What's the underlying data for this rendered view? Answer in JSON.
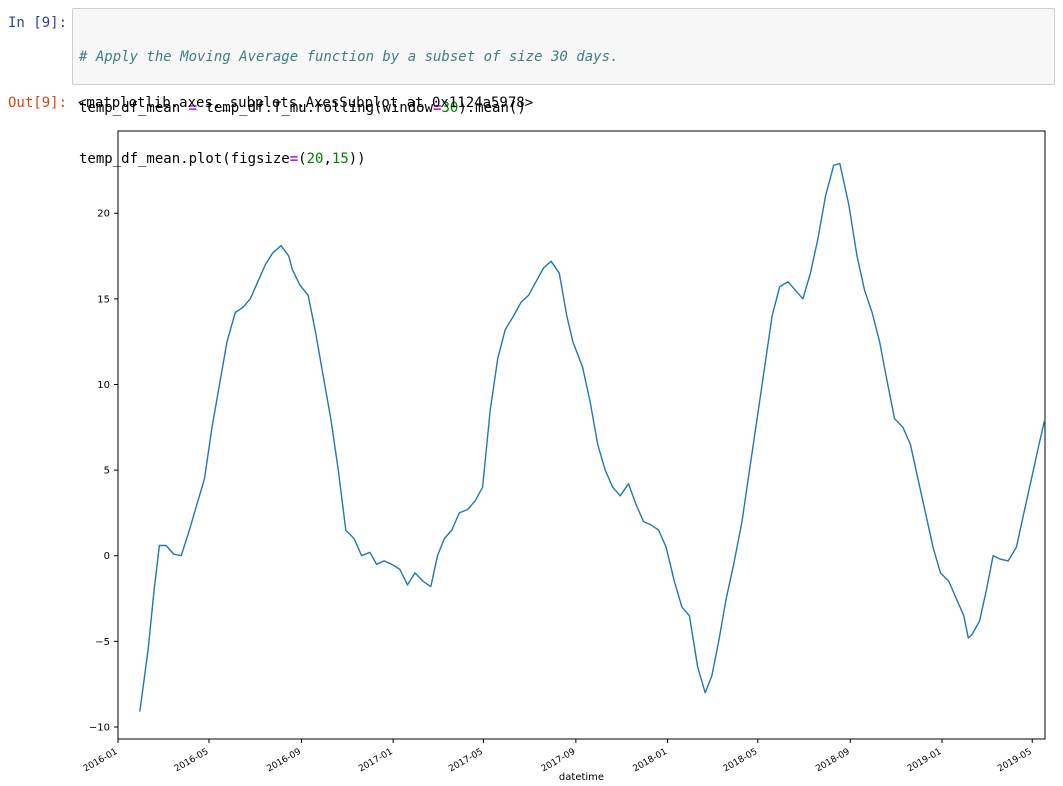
{
  "notebook": {
    "input_prompt": "In [9]:",
    "output_prompt": "Out[9]:",
    "code": {
      "comment": "# Apply the Moving Average function by a subset of size 30 days.",
      "line2_a": "temp_df_mean ",
      "line2_op": "=",
      "line2_b": " temp_df.T_mu.rolling(window",
      "line2_op2": "=",
      "line2_num": "30",
      "line2_c": ").mean()",
      "line3_a": "temp_df_mean.plot(figsize",
      "line3_op": "=",
      "line3_b": "(",
      "line3_num1": "20",
      "line3_sep": ",",
      "line3_num2": "15",
      "line3_c": "))"
    },
    "output_text": "<matplotlib.axes._subplots.AxesSubplot at 0x1124a5978>"
  },
  "colors": {
    "line": "#1f77b4",
    "axis": "#000000"
  },
  "chart_data": {
    "type": "line",
    "xlabel": "datetime",
    "ylabel": "",
    "title": "",
    "x_range": [
      "2016-01-01",
      "2019-05-18"
    ],
    "ylim": [
      -10.7,
      24.8
    ],
    "x_ticks": [
      "2016-01",
      "2016-05",
      "2016-09",
      "2017-01",
      "2017-05",
      "2017-09",
      "2018-01",
      "2018-05",
      "2018-09",
      "2019-01",
      "2019-05"
    ],
    "y_ticks": [
      -10,
      -5,
      0,
      5,
      10,
      15,
      20
    ],
    "grid": false,
    "series": [
      {
        "x": [
          "2016-01-30",
          "2016-02-10",
          "2016-02-18",
          "2016-02-25",
          "2016-03-05",
          "2016-03-15",
          "2016-03-25",
          "2016-04-05",
          "2016-04-15",
          "2016-04-25",
          "2016-05-05",
          "2016-05-15",
          "2016-05-25",
          "2016-06-05",
          "2016-06-15",
          "2016-06-25",
          "2016-07-05",
          "2016-07-15",
          "2016-07-25",
          "2016-08-05",
          "2016-08-15",
          "2016-08-20",
          "2016-08-30",
          "2016-09-10",
          "2016-09-20",
          "2016-09-30",
          "2016-10-10",
          "2016-10-20",
          "2016-10-30",
          "2016-11-10",
          "2016-11-20",
          "2016-12-01",
          "2016-12-10",
          "2016-12-20",
          "2016-12-30",
          "2017-01-10",
          "2017-01-20",
          "2017-01-30",
          "2017-02-10",
          "2017-02-20",
          "2017-03-01",
          "2017-03-10",
          "2017-03-20",
          "2017-03-30",
          "2017-04-10",
          "2017-04-20",
          "2017-04-30",
          "2017-05-10",
          "2017-05-20",
          "2017-05-30",
          "2017-06-10",
          "2017-06-20",
          "2017-06-30",
          "2017-07-10",
          "2017-07-20",
          "2017-07-30",
          "2017-08-10",
          "2017-08-20",
          "2017-08-28",
          "2017-09-10",
          "2017-09-20",
          "2017-09-30",
          "2017-10-10",
          "2017-10-20",
          "2017-10-30",
          "2017-11-10",
          "2017-11-20",
          "2017-11-30",
          "2017-12-10",
          "2017-12-20",
          "2017-12-30",
          "2018-01-10",
          "2018-01-20",
          "2018-01-30",
          "2018-02-10",
          "2018-02-20",
          "2018-03-01",
          "2018-03-10",
          "2018-03-20",
          "2018-03-30",
          "2018-04-10",
          "2018-04-20",
          "2018-04-30",
          "2018-05-10",
          "2018-05-20",
          "2018-05-30",
          "2018-06-10",
          "2018-06-20",
          "2018-06-30",
          "2018-07-10",
          "2018-07-20",
          "2018-07-30",
          "2018-08-10",
          "2018-08-18",
          "2018-08-30",
          "2018-09-10",
          "2018-09-20",
          "2018-09-30",
          "2018-10-10",
          "2018-10-20",
          "2018-10-30",
          "2018-11-10",
          "2018-11-20",
          "2018-11-30",
          "2018-12-10",
          "2018-12-20",
          "2018-12-30",
          "2019-01-10",
          "2019-01-20",
          "2019-01-30",
          "2019-02-05",
          "2019-02-10",
          "2019-02-20",
          "2019-03-01",
          "2019-03-10",
          "2019-03-20",
          "2019-03-30",
          "2019-04-10",
          "2019-04-20",
          "2019-04-30",
          "2019-05-10",
          "2019-05-18"
        ],
        "values": [
          -9.1,
          -5.5,
          -2.0,
          0.6,
          0.6,
          0.1,
          0.0,
          1.5,
          3.0,
          4.5,
          7.5,
          10.0,
          12.5,
          14.2,
          14.5,
          15.0,
          16.0,
          17.0,
          17.7,
          18.1,
          17.5,
          16.7,
          15.8,
          15.2,
          13.0,
          10.5,
          8.0,
          5.0,
          1.5,
          1.0,
          0.0,
          0.2,
          -0.5,
          -0.3,
          -0.5,
          -0.8,
          -1.7,
          -1.0,
          -1.5,
          -1.8,
          0.0,
          1.0,
          1.5,
          2.5,
          2.7,
          3.2,
          4.0,
          8.5,
          11.5,
          13.2,
          14.0,
          14.8,
          15.2,
          16.0,
          16.8,
          17.2,
          16.5,
          14.0,
          12.5,
          11.0,
          9.0,
          6.5,
          5.0,
          4.0,
          3.5,
          4.2,
          3.0,
          2.0,
          1.8,
          1.5,
          0.5,
          -1.5,
          -3.0,
          -3.5,
          -6.5,
          -8.0,
          -7.0,
          -5.0,
          -2.5,
          -0.5,
          2.0,
          5.0,
          8.0,
          11.0,
          14.0,
          15.7,
          16.0,
          15.5,
          15.0,
          16.5,
          18.5,
          21.0,
          22.8,
          22.9,
          20.5,
          17.5,
          15.5,
          14.2,
          12.5,
          10.2,
          8.0,
          7.5,
          6.5,
          4.5,
          2.5,
          0.5,
          -1.0,
          -1.5,
          -2.5,
          -3.5,
          -4.8,
          -4.6,
          -3.8,
          -2.0,
          0.0,
          -0.2,
          -0.3,
          0.5,
          2.5,
          4.5,
          6.5,
          8.0
        ],
        "values_note_is_not_present": false
      }
    ]
  }
}
